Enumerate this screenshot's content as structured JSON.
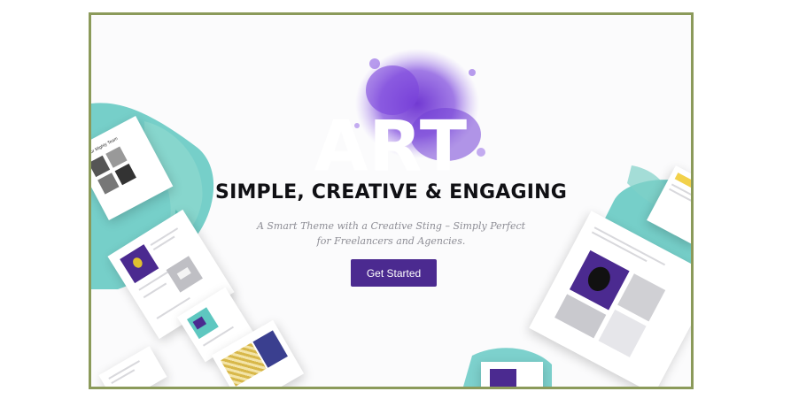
{
  "hero": {
    "title": "ART",
    "subtitle": "SIMPLE, CREATIVE & ENGAGING",
    "tagline_line1": "A Smart Theme with a Creative Sting – Simply Perfect",
    "tagline_line2": "for Freelancers and Agencies.",
    "cta_label": "Get Started"
  },
  "mockups": {
    "left_card_heading": "Our Mighty Team"
  },
  "colors": {
    "accent": "#4b2a90",
    "splash": "#7a4bd6",
    "teal": "#5ec7c0",
    "frame": "#8b9a5a"
  }
}
